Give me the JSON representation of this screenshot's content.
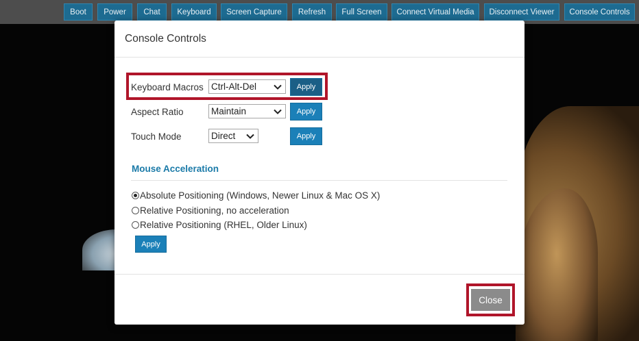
{
  "toolbar": {
    "buttons": [
      {
        "label": "Boot"
      },
      {
        "label": "Power"
      },
      {
        "label": "Chat"
      },
      {
        "label": "Keyboard"
      },
      {
        "label": "Screen Capture"
      },
      {
        "label": "Refresh"
      },
      {
        "label": "Full Screen"
      },
      {
        "label": "Connect Virtual Media"
      },
      {
        "label": "Disconnect Viewer"
      },
      {
        "label": "Console Controls"
      }
    ]
  },
  "modal": {
    "title": "Console Controls",
    "rows": [
      {
        "label": "Keyboard Macros",
        "value": "Ctrl-Alt-Del",
        "apply": "Apply"
      },
      {
        "label": "Aspect Ratio",
        "value": "Maintain",
        "apply": "Apply"
      },
      {
        "label": "Touch Mode",
        "value": "Direct",
        "apply": "Apply"
      }
    ],
    "mouse_section": {
      "heading": "Mouse Acceleration",
      "options": [
        {
          "label": "Absolute Positioning (Windows, Newer Linux & Mac OS X)",
          "selected": true
        },
        {
          "label": "Relative Positioning, no acceleration",
          "selected": false
        },
        {
          "label": "Relative Positioning (RHEL, Older Linux)",
          "selected": false
        }
      ],
      "apply": "Apply"
    },
    "close_label": "Close"
  },
  "colors": {
    "toolbar_button": "#1d6b91",
    "apply_button": "#1b80b8",
    "highlight": "#b0152a",
    "section_heading": "#1a7aa8",
    "close_button": "#8b8b8b"
  },
  "icons": {
    "select_arrow": "chevron-down-icon",
    "radio": "radio-icon"
  }
}
